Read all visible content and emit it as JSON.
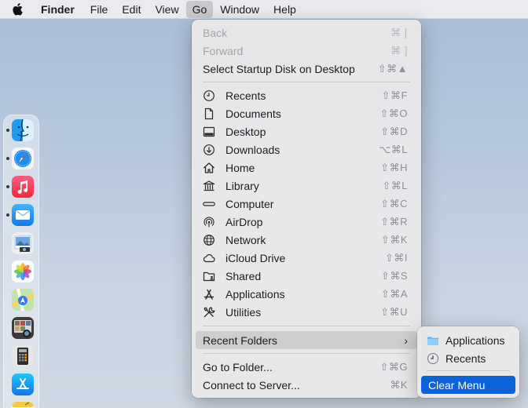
{
  "menubar": {
    "apple_icon": "apple-logo-icon",
    "app_name": "Finder",
    "items": [
      "File",
      "Edit",
      "View",
      "Go",
      "Window",
      "Help"
    ],
    "active_item": "Go"
  },
  "dock": {
    "apps": [
      {
        "name": "finder-icon",
        "running": true
      },
      {
        "name": "safari-icon",
        "running": true
      },
      {
        "name": "music-icon",
        "running": true
      },
      {
        "name": "mail-icon",
        "running": true
      },
      {
        "name": "preview-icon",
        "running": false
      },
      {
        "name": "photos-icon",
        "running": false
      },
      {
        "name": "maps-icon",
        "running": false
      },
      {
        "name": "image-capture-icon",
        "running": false
      },
      {
        "name": "calculator-icon",
        "running": false
      },
      {
        "name": "app-store-icon",
        "running": false
      },
      {
        "name": "notes-icon",
        "running": false
      }
    ]
  },
  "go_menu": {
    "back": {
      "label": "Back",
      "shortcut": "⌘ ["
    },
    "forward": {
      "label": "Forward",
      "shortcut": "⌘ ]"
    },
    "startup": {
      "label": "Select Startup Disk on Desktop",
      "shortcut": "⇧⌘▲"
    },
    "places": [
      {
        "label": "Recents",
        "shortcut": "⇧⌘F",
        "icon": "clock-icon"
      },
      {
        "label": "Documents",
        "shortcut": "⇧⌘O",
        "icon": "document-icon"
      },
      {
        "label": "Desktop",
        "shortcut": "⇧⌘D",
        "icon": "desktop-icon"
      },
      {
        "label": "Downloads",
        "shortcut": "⌥⌘L",
        "icon": "download-icon"
      },
      {
        "label": "Home",
        "shortcut": "⇧⌘H",
        "icon": "home-icon"
      },
      {
        "label": "Library",
        "shortcut": "⇧⌘L",
        "icon": "library-icon"
      },
      {
        "label": "Computer",
        "shortcut": "⇧⌘C",
        "icon": "computer-icon"
      },
      {
        "label": "AirDrop",
        "shortcut": "⇧⌘R",
        "icon": "airdrop-icon"
      },
      {
        "label": "Network",
        "shortcut": "⇧⌘K",
        "icon": "network-icon"
      },
      {
        "label": "iCloud Drive",
        "shortcut": "⇧⌘I",
        "icon": "icloud-icon"
      },
      {
        "label": "Shared",
        "shortcut": "⇧⌘S",
        "icon": "shared-folder-icon"
      },
      {
        "label": "Applications",
        "shortcut": "⇧⌘A",
        "icon": "applications-icon"
      },
      {
        "label": "Utilities",
        "shortcut": "⇧⌘U",
        "icon": "utilities-icon"
      }
    ],
    "recent_folders": {
      "label": "Recent Folders",
      "chevron": "›"
    },
    "go_to_folder": {
      "label": "Go to Folder...",
      "shortcut": "⇧⌘G"
    },
    "connect": {
      "label": "Connect to Server...",
      "shortcut": "⌘K"
    }
  },
  "recent_folders_menu": {
    "items": [
      {
        "label": "Applications",
        "icon": "folder-icon"
      },
      {
        "label": "Recents",
        "icon": "clock-icon"
      }
    ],
    "clear": "Clear Menu"
  },
  "colors": {
    "selection": "#0a63d8",
    "disabled_text": "#a3a3a6"
  }
}
